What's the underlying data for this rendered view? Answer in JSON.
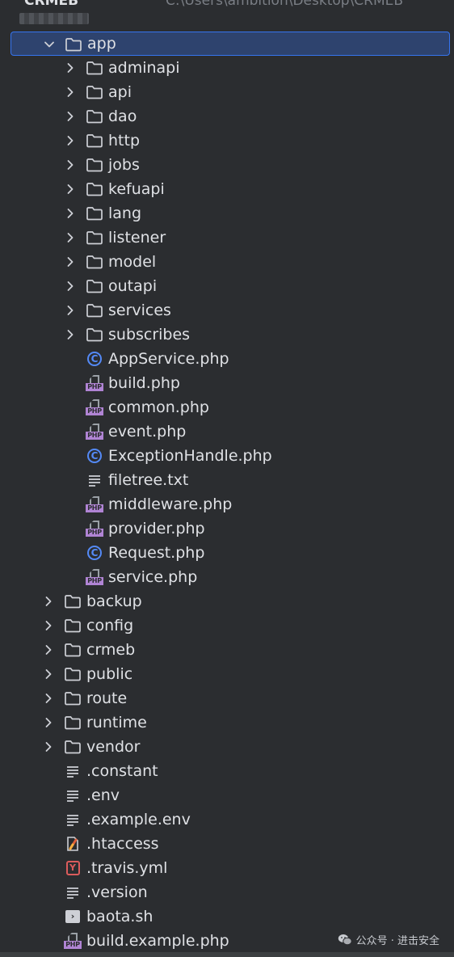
{
  "header": {
    "project_name": "CRMEB",
    "project_path": "C:\\Users\\ambition\\Desktop\\CRMEB"
  },
  "tree": [
    {
      "label": "app",
      "kind": "folder",
      "level": 0,
      "expanded": true,
      "selected": true
    },
    {
      "label": "adminapi",
      "kind": "folder",
      "level": 2,
      "expanded": false
    },
    {
      "label": "api",
      "kind": "folder",
      "level": 2,
      "expanded": false
    },
    {
      "label": "dao",
      "kind": "folder",
      "level": 2,
      "expanded": false
    },
    {
      "label": "http",
      "kind": "folder",
      "level": 2,
      "expanded": false
    },
    {
      "label": "jobs",
      "kind": "folder",
      "level": 2,
      "expanded": false
    },
    {
      "label": "kefuapi",
      "kind": "folder",
      "level": 2,
      "expanded": false
    },
    {
      "label": "lang",
      "kind": "folder",
      "level": 2,
      "expanded": false
    },
    {
      "label": "listener",
      "kind": "folder",
      "level": 2,
      "expanded": false
    },
    {
      "label": "model",
      "kind": "folder",
      "level": 2,
      "expanded": false
    },
    {
      "label": "outapi",
      "kind": "folder",
      "level": 2,
      "expanded": false
    },
    {
      "label": "services",
      "kind": "folder",
      "level": 2,
      "expanded": false
    },
    {
      "label": "subscribes",
      "kind": "folder",
      "level": 2,
      "expanded": false
    },
    {
      "label": "AppService.php",
      "kind": "class",
      "level": 2
    },
    {
      "label": "build.php",
      "kind": "php",
      "level": 2
    },
    {
      "label": "common.php",
      "kind": "php",
      "level": 2
    },
    {
      "label": "event.php",
      "kind": "php",
      "level": 2
    },
    {
      "label": "ExceptionHandle.php",
      "kind": "class",
      "level": 2
    },
    {
      "label": "filetree.txt",
      "kind": "text",
      "level": 2
    },
    {
      "label": "middleware.php",
      "kind": "php",
      "level": 2
    },
    {
      "label": "provider.php",
      "kind": "php",
      "level": 2
    },
    {
      "label": "Request.php",
      "kind": "class",
      "level": 2
    },
    {
      "label": "service.php",
      "kind": "php",
      "level": 2
    },
    {
      "label": "backup",
      "kind": "folder",
      "level": 1,
      "expanded": false
    },
    {
      "label": "config",
      "kind": "folder",
      "level": 1,
      "expanded": false
    },
    {
      "label": "crmeb",
      "kind": "folder",
      "level": 1,
      "expanded": false
    },
    {
      "label": "public",
      "kind": "folder",
      "level": 1,
      "expanded": false
    },
    {
      "label": "route",
      "kind": "folder",
      "level": 1,
      "expanded": false
    },
    {
      "label": "runtime",
      "kind": "folder",
      "level": 1,
      "expanded": false
    },
    {
      "label": "vendor",
      "kind": "folder",
      "level": 1,
      "expanded": false
    },
    {
      "label": ".constant",
      "kind": "text",
      "level": 1
    },
    {
      "label": ".env",
      "kind": "text",
      "level": 1
    },
    {
      "label": ".example.env",
      "kind": "text",
      "level": 1
    },
    {
      "label": ".htaccess",
      "kind": "htaccess",
      "level": 1
    },
    {
      "label": ".travis.yml",
      "kind": "yml",
      "level": 1
    },
    {
      "label": ".version",
      "kind": "text",
      "level": 1
    },
    {
      "label": "baota.sh",
      "kind": "shell",
      "level": 1
    },
    {
      "label": "build.example.php",
      "kind": "php",
      "level": 1
    }
  ],
  "icons": {
    "php_tag": "PHP",
    "class_glyph": "C",
    "yml_glyph": "Y",
    "shell_glyph": "›"
  },
  "watermark": {
    "text": "公众号 · 进击安全"
  },
  "colors": {
    "background": "#2b2d30",
    "selection": "#2e436e",
    "selection_border": "#3574f0",
    "text": "#dfe1e5",
    "class_icon": "#548af7",
    "php_icon": "#b084d4",
    "yml_icon": "#db5c5c"
  }
}
